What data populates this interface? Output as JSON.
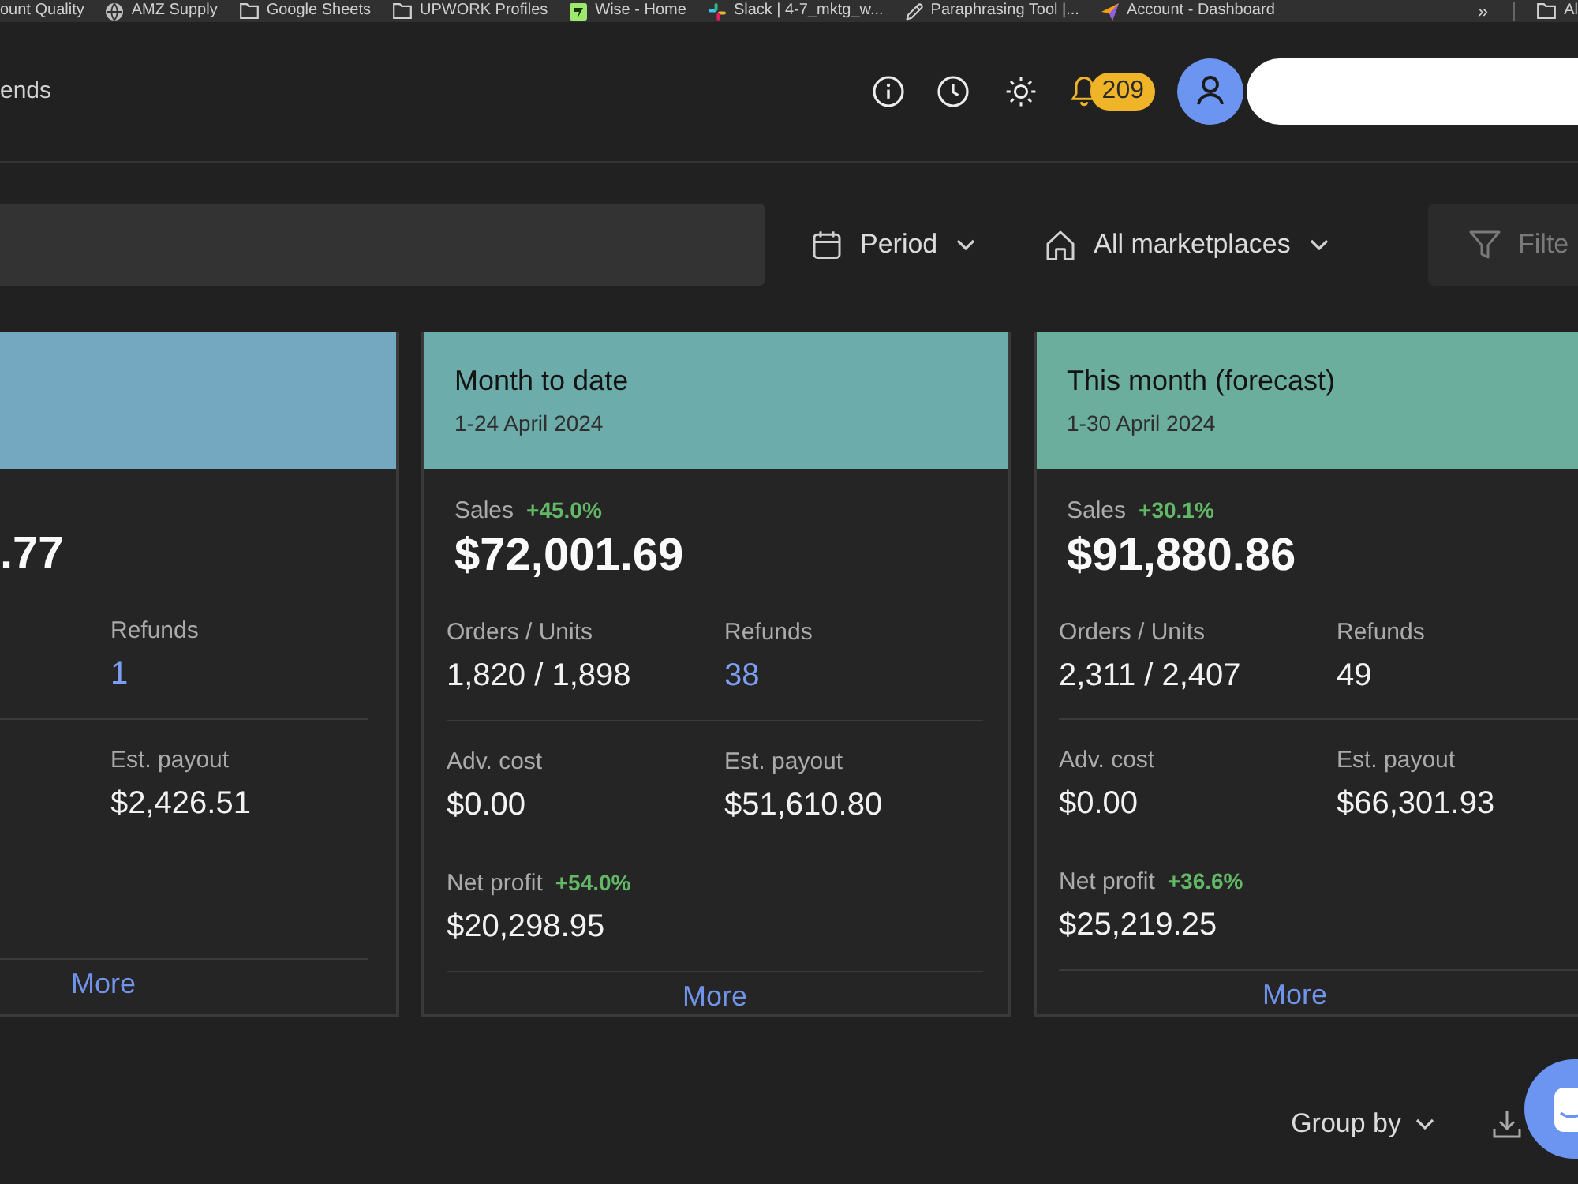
{
  "bookmarks_bar": {
    "items": [
      {
        "kind": "site",
        "label": "ount Quality"
      },
      {
        "kind": "site",
        "label": "AMZ Supply"
      },
      {
        "kind": "folder",
        "label": "Google Sheets"
      },
      {
        "kind": "folder",
        "label": "UPWORK Profiles"
      },
      {
        "kind": "site",
        "label": "Wise - Home"
      },
      {
        "kind": "site",
        "label": "Slack | 4-7_mktg_w..."
      },
      {
        "kind": "site",
        "label": "Paraphrasing Tool |..."
      },
      {
        "kind": "site",
        "label": "Account - Dashboard"
      }
    ],
    "overflow": "»",
    "end_items": [
      {
        "kind": "folder",
        "label": "Al"
      }
    ]
  },
  "header": {
    "title": "ends",
    "notification_count": "209"
  },
  "filters": {
    "period": "Period",
    "marketplace": "All marketplaces",
    "filter": "Filte"
  },
  "cards": [
    {
      "kind": "clipped-left",
      "color": "#74a8c0",
      "sales": {
        "value": ".77"
      },
      "sections": [
        [
          {
            "label": "Refunds",
            "value": "1",
            "link": true
          }
        ],
        [
          {
            "label": "Est. payout",
            "value": "$2,426.51",
            "link": false
          }
        ]
      ],
      "more": "More"
    },
    {
      "kind": "full",
      "color": "#6cacaa",
      "title": "Month to date",
      "date": "1-24 April 2024",
      "sales": {
        "label": "Sales",
        "change": "+45.0%",
        "value": "$72,001.69"
      },
      "sections": [
        [
          {
            "label": "Orders / Units",
            "value": "1,820 / 1,898",
            "link": false
          },
          {
            "label": "Refunds",
            "value": "38",
            "link": true
          }
        ],
        [
          {
            "label": "Adv. cost",
            "value": "$0.00",
            "link": false
          },
          {
            "label": "Est. payout",
            "value": "$51,610.80",
            "link": false
          },
          {
            "label": "Net profit",
            "change": "+54.0%",
            "value": "$20,298.95",
            "link": false
          }
        ]
      ],
      "more": "More"
    },
    {
      "kind": "clipped-right",
      "color": "#6bae9e",
      "title": "This month (forecast)",
      "date": "1-30 April 2024",
      "sales": {
        "label": "Sales",
        "change": "+30.1%",
        "value": "$91,880.86"
      },
      "sections": [
        [
          {
            "label": "Orders / Units",
            "value": "2,311 / 2,407",
            "link": false
          },
          {
            "label": "Refunds",
            "value": "49",
            "link": false
          }
        ],
        [
          {
            "label": "Adv. cost",
            "value": "$0.00",
            "link": false
          },
          {
            "label": "Est. payout",
            "value": "$66,301.93",
            "link": false
          },
          {
            "label": "Net profit",
            "change": "+36.6%",
            "value": "$25,219.25",
            "link": false
          }
        ]
      ],
      "more": "More"
    }
  ],
  "footer": {
    "group_by": "Group by"
  }
}
